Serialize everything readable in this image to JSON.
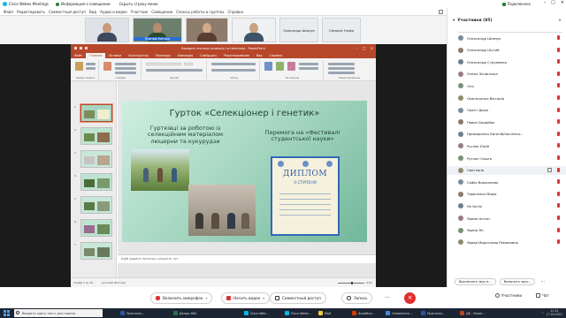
{
  "titlebar": {
    "app": "Cisco Webex Meetings",
    "info": "Информация о совещании",
    "hide": "Скрыть строку меню",
    "connected": "Подключено"
  },
  "menu": [
    "Файл",
    "Редактировать",
    "Совместный доступ",
    "Вид",
    "Аудио и видео",
    "Участник",
    "Совещание",
    "Сеансы работы в группах",
    "Справка"
  ],
  "videos": [
    {
      "name": ""
    },
    {
      "name": "Ясинюк Наталя"
    },
    {
      "name": ""
    },
    {
      "name": ""
    },
    {
      "name": "Олександр Шевчук"
    },
    {
      "name": "Olexandr Hvaka"
    }
  ],
  "ppt": {
    "doc_title": "Бакарня гентика селекція та генетики - PowerPoint",
    "tabs": [
      "Файл",
      "Главная",
      "Вставка",
      "Конструктор",
      "Переходи",
      "Анимация",
      "Слайд-шоу",
      "Рецензирование",
      "Вид",
      "Справка"
    ],
    "ribbon_groups": [
      "Буфер обмена",
      "Слайды",
      "Шрифт",
      "Абзац",
      "Рисование",
      "Редактирование"
    ],
    "notes_placeholder": "Щоб додати нотатки, клацніть тут",
    "status_left": "Слайд 1 из 10",
    "status_lang": "русский (Россия)",
    "zoom": "53%"
  },
  "slide": {
    "title": "Гурток «Селекціонер і генетик»",
    "left_text": "Гуртківці за роботою із селекційним матеріалом люцерни та кукурудзи",
    "right_text": "Перемога на «Фестивалі студентської науки»",
    "diploma_title": "ДИПЛОМ",
    "diploma_sub": "ІІ СТУПЕНЯ"
  },
  "controls": {
    "unmute": "Включить микрофон",
    "video": "Начать видео",
    "share": "Совместный доступ",
    "record": "Запись",
    "participants": "Участники",
    "chat": "Чат"
  },
  "panel": {
    "title": "Участники (85)",
    "participants": [
      "Олександр Шевчук",
      "Олександр Шутий",
      "Олександр Струменко",
      "Олена Зачинська",
      "Оля",
      "Омельченко Вікторія",
      "Орест Дошк",
      "Павел Бердійок",
      "Приморенко Євгеній/Ільченко...",
      "Руснак Юрій",
      "Руслан Смыга",
      "Светлана",
      "Софія Воржанова",
      "Тарасенко Марія",
      "Ян Беліх",
      "Ярема Антон",
      "Ярина Ян",
      "Ярова Мирослава Романовна"
    ],
    "mute_all": "Выключить звук в...",
    "unmute_all": "Включить звук..."
  },
  "taskbar": {
    "search": "Введите здесь текст для поиска",
    "apps": [
      "Протокол...",
      "Денди 884",
      "Cisco Web...",
      "Cisco Webe...",
      "Мой",
      "Агробіол...",
      "Оновлення...",
      "Протокол...",
      "ДБ - Power..."
    ],
    "time": "11:22",
    "date": "17.04.2021"
  }
}
